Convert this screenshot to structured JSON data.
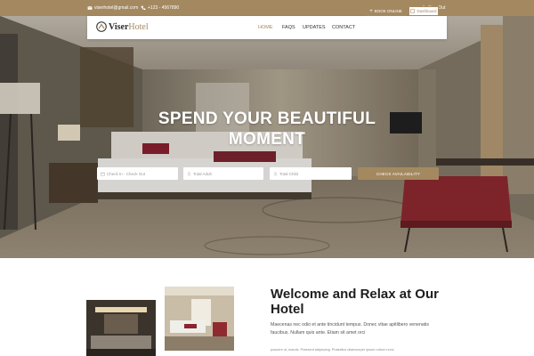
{
  "topbar": {
    "email": "viserhotel@gmail.com",
    "phone": "+123 - 4567890",
    "sign_out": "Sign Out"
  },
  "nav": {
    "logo_part1": "Viser",
    "logo_part2": "Hotel",
    "menu": [
      "HOME",
      "FAQS",
      "UPDATES",
      "CONTACT"
    ],
    "active_item": "HOME",
    "book_online": "BOOK ONLINE",
    "dashboard": "Dashboard"
  },
  "hero": {
    "headline_line1": "SPEND YOUR BEAUTIFUL",
    "headline_line2": "MOMENT"
  },
  "search": {
    "dates_placeholder": "Check In - Check Out",
    "adults_placeholder": "Total Adult",
    "child_placeholder": "Total Child",
    "button": "CHECK AVAILABILITY"
  },
  "about": {
    "title": "Welcome and Relax at Our Hotel",
    "paragraph": "Maecenas nec odio et ante tincidunt tempus. Donec vitae apitlibero venenatis faucibus. Nullam quis ante. Etiam sit amet orci",
    "paragraph_small": "posuere ut, mauris. Praesent adipiscing. Phasellus ullamcorper ipsum rutrum nunc"
  },
  "colors": {
    "accent": "#a48960",
    "heading": "#1e1e1e"
  },
  "icons": {
    "email": "envelope-icon",
    "phone": "phone-icon",
    "sign_out": "user-icon",
    "calendar": "calendar-icon",
    "person": "person-icon"
  }
}
